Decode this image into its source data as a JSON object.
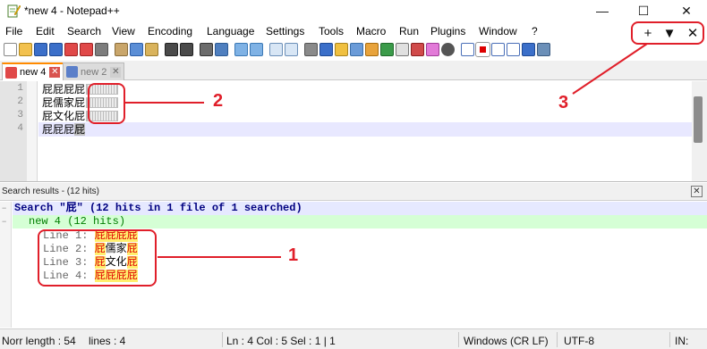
{
  "window": {
    "title": "*new 4 - Notepad++",
    "minimize_glyph": "—",
    "maximize_glyph": "☐",
    "close_glyph": "✕"
  },
  "menu": {
    "items": [
      "File",
      "Edit",
      "Search",
      "View",
      "Encoding",
      "Language",
      "Settings",
      "Tools",
      "Macro",
      "Run",
      "Plugins",
      "Window",
      "?"
    ]
  },
  "panel_buttons": {
    "add": "+",
    "dropdown": "▼",
    "close": "✕"
  },
  "tabs": [
    {
      "label": "new 4",
      "active": true
    },
    {
      "label": "new 2",
      "active": false
    }
  ],
  "editor": {
    "line_numbers": [
      "1",
      "2",
      "3",
      "4"
    ],
    "lines": [
      "屁屁屁屁",
      "屁儒家屁",
      "屁文化屁",
      "屁屁屁屁"
    ]
  },
  "search_results": {
    "title": "Search results - (12 hits)",
    "search_line": "Search \"屁\" (12 hits in 1 file of 1 searched)",
    "file_line": "new 4 (12 hits)",
    "hits": [
      {
        "prefix": "Line 1: ",
        "text": "屁屁屁屁"
      },
      {
        "prefix": "Line 2: ",
        "text": "屁儒家屁"
      },
      {
        "prefix": "Line 3: ",
        "text": "屁文化屁"
      },
      {
        "prefix": "Line 4: ",
        "text": "屁屁屁屁"
      }
    ]
  },
  "statusbar": {
    "length": "Norr length : 54",
    "lines": "lines : 4",
    "position": "Ln : 4    Col : 5    Sel : 1 | 1",
    "eol": "Windows (CR LF)",
    "encoding": "UTF-8",
    "ins": "IN:"
  },
  "annotations": {
    "label_1": "1",
    "label_2": "2",
    "label_3": "3"
  },
  "colors": {
    "annotation": "#e01f2a",
    "hit_highlight": "#ffef6e",
    "hit_text": "#e00000",
    "search_header": "#000080",
    "file_header": "#008000"
  }
}
